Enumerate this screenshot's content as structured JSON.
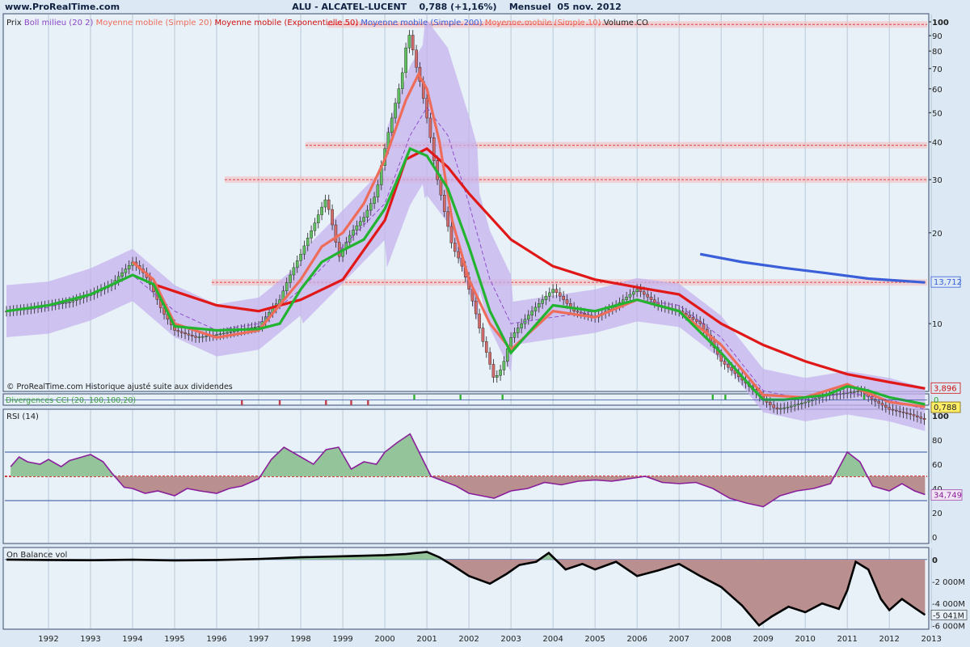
{
  "header": {
    "site": "www.ProRealTime.com",
    "title": "ALU - ALCATEL-LUCENT    0,788 (+1,16%)    Mensuel  05 nov. 2012"
  },
  "colors": {
    "panel_bg": "#e8f1f8",
    "frame_bg": "#dce9f4",
    "candle_up": "#5fbf5f",
    "candle_down": "#d36a6a",
    "bollinger_fill": "#c6b2ee",
    "ma20": "#ee6c5a",
    "ema50": "#e01818",
    "sma200": "#3a5fd8",
    "sma10_green": "#22b430",
    "rsi_line": "#8a1f9b",
    "rsi_pos": "#93c49a",
    "rsi_neg": "#b98f90",
    "obv_line": "#000000",
    "obv_pos": "#93c49a",
    "obv_neg": "#b98f90",
    "level_line": "#e04040",
    "grid": "#b8c8d8"
  },
  "legend": [
    {
      "label": "Prix",
      "color": "#202020"
    },
    {
      "label": "Boll milieu (20 2)",
      "color": "#8a44c8"
    },
    {
      "label": "Moyenne mobile (Simple 20)",
      "color": "#ee6c5a"
    },
    {
      "label": "Moyenne mobile (Exponentielle 50)",
      "color": "#d01010"
    },
    {
      "label": "Moyenne mobile (Simple 200)",
      "color": "#3a5fd8"
    },
    {
      "label": "Moyenne mobile (Simple 10)",
      "color": "#ee6c5a"
    },
    {
      "label": "Volume CO",
      "color": "#202020"
    }
  ],
  "footnote": "© ProRealTime.com Historique ajusté suite aux dividendes",
  "chart_data": [
    {
      "type": "line",
      "id": "price",
      "x_ticks": [
        "1992",
        "1993",
        "1994",
        "1995",
        "1996",
        "1997",
        "1998",
        "1999",
        "2000",
        "2001",
        "2002",
        "2003",
        "2004",
        "2005",
        "2006",
        "2007",
        "2008",
        "2009",
        "2010",
        "2011",
        "2012",
        "2013"
      ],
      "x_range": [
        1991.0,
        2012.9
      ],
      "y_scale": "log",
      "y_ticks": [
        "100",
        "90",
        "80",
        "70",
        "60",
        "50",
        "40",
        "30",
        "20",
        "10"
      ],
      "y_range": [
        6.5,
        100
      ],
      "last_labels": [
        "13,712",
        "3,896",
        "0,788"
      ],
      "support_levels": [
        98,
        39,
        30,
        13.7
      ],
      "price": {
        "x": [
          1991.0,
          1991.5,
          1992.0,
          1992.5,
          1993.0,
          1993.5,
          1994.0,
          1994.3,
          1994.7,
          1995.0,
          1995.5,
          1996.0,
          1996.5,
          1997.0,
          1997.5,
          1998.0,
          1998.3,
          1998.6,
          1998.9,
          1999.2,
          1999.5,
          1999.8,
          2000.0,
          2000.2,
          2000.4,
          2000.5,
          2000.6,
          2000.7,
          2000.85,
          2001.0,
          2001.2,
          2001.4,
          2001.6,
          2001.8,
          2002.0,
          2002.3,
          2002.6,
          2002.8,
          2003.0,
          2003.5,
          2004.0,
          2004.5,
          2005.0,
          2005.5,
          2006.0,
          2006.5,
          2007.0,
          2007.5,
          2008.0,
          2008.5,
          2009.0,
          2009.3,
          2009.6,
          2010.0,
          2010.5,
          2011.0,
          2011.3,
          2011.6,
          2012.0,
          2012.5,
          2012.85
        ],
        "y": [
          11.0,
          11.2,
          11.5,
          11.8,
          12.5,
          13.5,
          16.0,
          14.5,
          11.0,
          9.5,
          9.0,
          9.2,
          9.5,
          9.8,
          12.0,
          17.0,
          21.0,
          26.0,
          16.5,
          20.0,
          22.5,
          27.0,
          38.0,
          50.0,
          65.0,
          82.0,
          92.0,
          75.0,
          62.0,
          48.0,
          32.0,
          24.0,
          18.0,
          16.0,
          13.0,
          9.0,
          6.5,
          7.2,
          9.0,
          11.0,
          13.0,
          11.0,
          10.5,
          11.5,
          13.0,
          11.5,
          11.0,
          10.0,
          7.5,
          6.5,
          5.6,
          5.2,
          5.3,
          5.5,
          5.8,
          5.9,
          6.0,
          5.6,
          5.2,
          5.0,
          4.8
        ]
      },
      "series": [
        {
          "name": "Boll milieu (20 2)",
          "x": [
            1991.0,
            1992.0,
            1993.0,
            1994.0,
            1995.0,
            1996.0,
            1997.0,
            1998.0,
            1999.0,
            2000.0,
            2000.6,
            2001.0,
            2001.5,
            2002.0,
            2002.5,
            2003.0,
            2004.0,
            2005.0,
            2006.0,
            2007.0,
            2008.0,
            2009.0,
            2010.0,
            2011.0,
            2012.0,
            2012.85
          ],
          "y": [
            11.0,
            11.3,
            12.5,
            14.5,
            11.0,
            9.5,
            10.0,
            13.0,
            18.0,
            25.0,
            42.0,
            52.0,
            42.0,
            25.0,
            14.0,
            10.0,
            10.5,
            11.0,
            12.0,
            11.5,
            9.0,
            6.0,
            5.6,
            5.9,
            5.6,
            5.2
          ]
        },
        {
          "name": "Moyenne mobile (Simple 20)",
          "x": [
            1994.0,
            1994.5,
            1995.0,
            1996.0,
            1997.0,
            1998.0,
            1998.5,
            1999.0,
            1999.5,
            2000.0,
            2000.5,
            2000.8,
            2001.0,
            2001.3,
            2001.6,
            2002.0,
            2002.5,
            2003.0,
            2004.0,
            2005.0,
            2006.0,
            2007.0,
            2008.0,
            2009.0,
            2010.0,
            2011.0,
            2012.0,
            2012.85
          ],
          "y": [
            16.0,
            14.0,
            10.0,
            9.0,
            9.5,
            14.0,
            18.0,
            20.0,
            25.0,
            35.0,
            55.0,
            67.0,
            60.0,
            40.0,
            22.0,
            14.0,
            10.0,
            8.2,
            11.0,
            10.5,
            12.0,
            11.0,
            8.5,
            5.8,
            5.7,
            6.3,
            5.5,
            5.3
          ]
        },
        {
          "name": "Moyenne mobile (Exponentielle 50)",
          "x": [
            1994.5,
            1995.0,
            1996.0,
            1997.0,
            1998.0,
            1999.0,
            2000.0,
            2000.5,
            2001.0,
            2001.5,
            2002.0,
            2003.0,
            2004.0,
            2005.0,
            2006.0,
            2007.0,
            2008.0,
            2009.0,
            2010.0,
            2011.0,
            2012.0,
            2012.85
          ],
          "y": [
            13.5,
            12.8,
            11.5,
            11.0,
            12.0,
            14.0,
            22.0,
            35.0,
            38.0,
            33.0,
            27.0,
            19.0,
            15.5,
            14.0,
            13.2,
            12.5,
            10.0,
            8.5,
            7.5,
            6.8,
            6.4,
            6.1
          ]
        },
        {
          "name": "Moyenne mobile (Simple 200)",
          "x": [
            2007.5,
            2008.5,
            2009.5,
            2010.5,
            2011.5,
            2012.85
          ],
          "y": [
            17.0,
            16.0,
            15.3,
            14.7,
            14.1,
            13.7
          ]
        },
        {
          "name": "Moyenne mobile (Simple 10)",
          "x": [
            1991.0,
            1992.0,
            1993.0,
            1994.0,
            1994.5,
            1995.0,
            1996.0,
            1997.0,
            1997.5,
            1998.0,
            1998.5,
            1999.0,
            1999.5,
            2000.0,
            2000.3,
            2000.6,
            2001.0,
            2001.5,
            2002.0,
            2002.5,
            2003.0,
            2004.0,
            2005.0,
            2006.0,
            2007.0,
            2008.0,
            2008.7,
            2009.0,
            2009.5,
            2010.0,
            2010.5,
            2011.0,
            2011.5,
            2012.0,
            2012.85
          ],
          "y": [
            11.0,
            11.5,
            12.5,
            14.5,
            13.5,
            9.8,
            9.5,
            9.6,
            10.0,
            13.0,
            16.0,
            17.5,
            19.0,
            24.0,
            30.0,
            38.0,
            36.0,
            28.0,
            18.0,
            11.0,
            8.0,
            11.5,
            11.0,
            12.0,
            11.0,
            8.0,
            6.2,
            5.6,
            5.6,
            5.7,
            5.8,
            6.2,
            6.0,
            5.7,
            5.4
          ]
        }
      ]
    },
    {
      "type": "bar",
      "id": "divergences",
      "title": "Divergences CCI (20, 100,100,20)",
      "last_label": "0",
      "up_marks": [
        2000.7,
        2001.8,
        2002.8,
        2007.8,
        2008.1,
        2011.4
      ],
      "down_marks": [
        1996.6,
        1997.5,
        1998.6,
        1999.2,
        1999.6
      ]
    },
    {
      "type": "area",
      "id": "rsi",
      "title": "RSI (14)",
      "y_ticks": [
        "100",
        "80",
        "60",
        "40",
        "20",
        "0"
      ],
      "y_range": [
        0,
        100
      ],
      "bands": [
        70,
        50,
        30
      ],
      "last_label": "34,749",
      "x": [
        1991.1,
        1991.3,
        1991.5,
        1991.8,
        1992.0,
        1992.3,
        1992.5,
        1992.8,
        1993.0,
        1993.3,
        1993.5,
        1993.8,
        1994.0,
        1994.3,
        1994.6,
        1995.0,
        1995.3,
        1995.6,
        1996.0,
        1996.3,
        1996.6,
        1997.0,
        1997.3,
        1997.6,
        1998.0,
        1998.3,
        1998.6,
        1998.9,
        1999.2,
        1999.5,
        1999.8,
        2000.0,
        2000.3,
        2000.6,
        2000.9,
        2001.1,
        2001.4,
        2001.7,
        2002.0,
        2002.3,
        2002.6,
        2003.0,
        2003.4,
        2003.8,
        2004.2,
        2004.6,
        2005.0,
        2005.4,
        2005.8,
        2006.2,
        2006.6,
        2007.0,
        2007.4,
        2007.8,
        2008.2,
        2008.6,
        2009.0,
        2009.4,
        2009.8,
        2010.2,
        2010.6,
        2011.0,
        2011.3,
        2011.6,
        2012.0,
        2012.3,
        2012.6,
        2012.85
      ],
      "y": [
        58,
        66,
        62,
        60,
        64,
        58,
        63,
        66,
        68,
        62,
        53,
        41,
        40,
        36,
        38,
        34,
        40,
        38,
        36,
        40,
        42,
        48,
        64,
        74,
        66,
        60,
        72,
        74,
        56,
        62,
        60,
        70,
        78,
        85,
        64,
        50,
        46,
        42,
        36,
        34,
        32,
        38,
        40,
        45,
        43,
        46,
        47,
        46,
        48,
        50,
        45,
        44,
        45,
        40,
        32,
        28,
        25,
        34,
        38,
        40,
        44,
        70,
        62,
        42,
        38,
        44,
        38,
        35
      ]
    },
    {
      "type": "area",
      "id": "obv",
      "title": "On Balance vol",
      "y_ticks": [
        "0",
        "-2 000M",
        "-4 000M",
        "-6 000M"
      ],
      "y_range": [
        -6200,
        800
      ],
      "last_label": "-5 041M",
      "x": [
        1991.0,
        1992.0,
        1993.0,
        1994.0,
        1995.0,
        1996.0,
        1997.0,
        1998.0,
        1999.0,
        2000.0,
        2000.5,
        2001.0,
        2001.3,
        2001.6,
        2002.0,
        2002.5,
        2002.9,
        2003.2,
        2003.6,
        2003.9,
        2004.3,
        2004.7,
        2005.0,
        2005.5,
        2006.0,
        2006.5,
        2007.0,
        2007.5,
        2008.0,
        2008.5,
        2008.9,
        2009.2,
        2009.6,
        2010.0,
        2010.4,
        2010.8,
        2011.0,
        2011.2,
        2011.5,
        2011.8,
        2012.0,
        2012.3,
        2012.6,
        2012.85
      ],
      "y": [
        0,
        -40,
        -60,
        -20,
        -80,
        -40,
        50,
        200,
        300,
        400,
        500,
        700,
        200,
        -500,
        -1500,
        -2200,
        -1300,
        -500,
        -200,
        600,
        -900,
        -400,
        -900,
        -200,
        -1500,
        -1000,
        -400,
        -1500,
        -2500,
        -4200,
        -6000,
        -5200,
        -4300,
        -4800,
        -4000,
        -4500,
        -2800,
        -200,
        -900,
        -3600,
        -4600,
        -3600,
        -4400,
        -5041
      ]
    }
  ]
}
